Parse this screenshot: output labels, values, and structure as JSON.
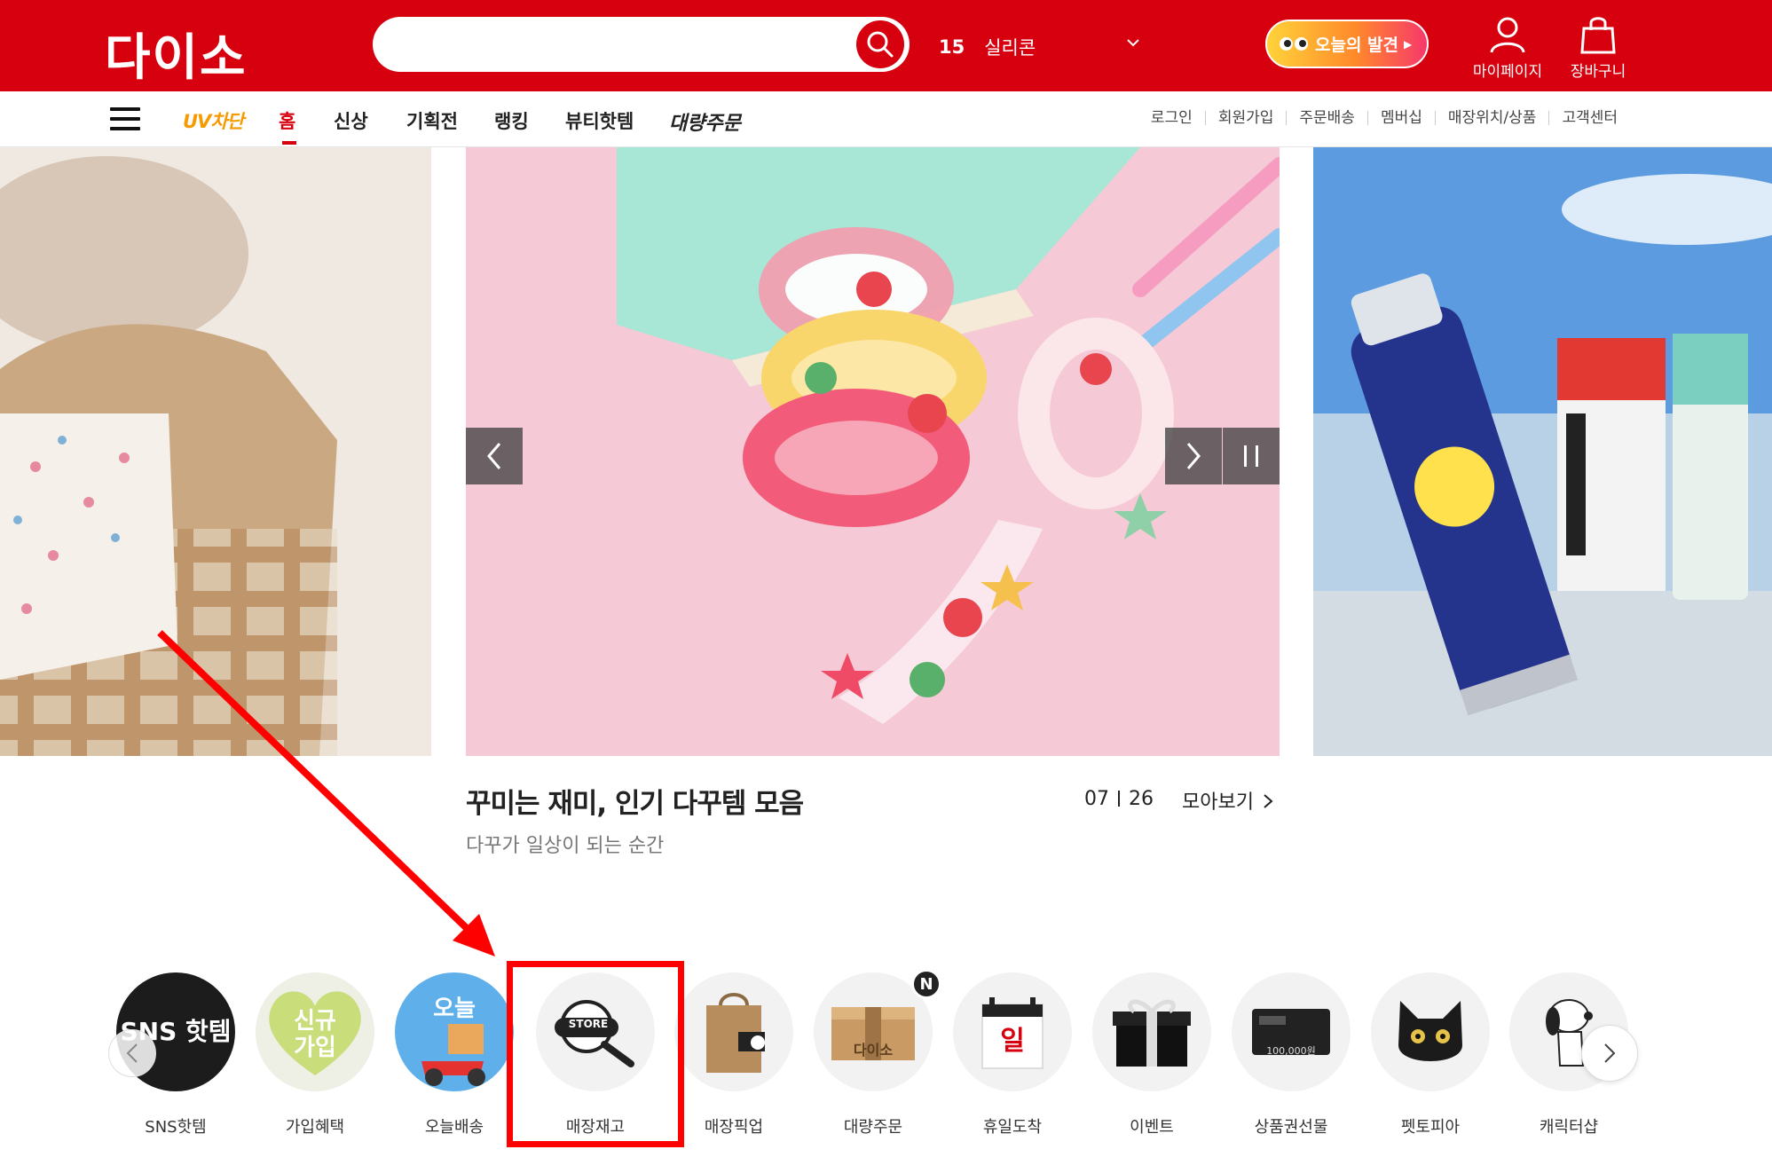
{
  "brand": {
    "logo_text": "다이소",
    "primary_color": "#d7000f"
  },
  "header": {
    "search": {
      "placeholder": ""
    },
    "trending": {
      "rank": "15",
      "keyword": "실리콘"
    },
    "discover_label": "오늘의 발견",
    "mypage_label": "마이페이지",
    "cart_label": "장바구니"
  },
  "nav": {
    "uv_label": "UV차단",
    "items": [
      "홈",
      "신상",
      "기획전",
      "랭킹",
      "뷰티핫템",
      "대량주문"
    ],
    "util_links": [
      "로그인",
      "회원가입",
      "주문배송",
      "멤버십",
      "매장위치/상품",
      "고객센터"
    ]
  },
  "banner": {
    "title": "꾸미는 재미, 인기 다꾸템 모음",
    "subtitle": "다꾸가 일상이 되는 순간",
    "current": "07",
    "total": "26",
    "more_label": "모아보기",
    "center_image": "washi-tape-stationery",
    "right_image": "sunscreen-products"
  },
  "quick_menu": [
    {
      "label": "SNS핫템",
      "icon": "sns-hot-item-icon",
      "icon_text": "SNS 핫템"
    },
    {
      "label": "가입혜택",
      "icon": "signup-heart-icon",
      "icon_text": "신규 가입"
    },
    {
      "label": "오늘배송",
      "icon": "scooter-delivery-icon",
      "icon_text": "오늘"
    },
    {
      "label": "매장재고",
      "icon": "store-magnifier-icon",
      "icon_text": "STORE"
    },
    {
      "label": "매장픽업",
      "icon": "shopping-bag-icon"
    },
    {
      "label": "대량주문",
      "icon": "box-icon",
      "icon_text": "다이소",
      "badge": "N"
    },
    {
      "label": "휴일도착",
      "icon": "calendar-sunday-icon",
      "icon_text": "일"
    },
    {
      "label": "이벤트",
      "icon": "gift-box-icon"
    },
    {
      "label": "상품권선물",
      "icon": "gift-card-icon",
      "icon_text": "100,000원"
    },
    {
      "label": "펫토피아",
      "icon": "black-cat-icon"
    },
    {
      "label": "캐릭터샵",
      "icon": "snoopy-icon"
    }
  ],
  "annotation": {
    "color": "#ff0000"
  }
}
